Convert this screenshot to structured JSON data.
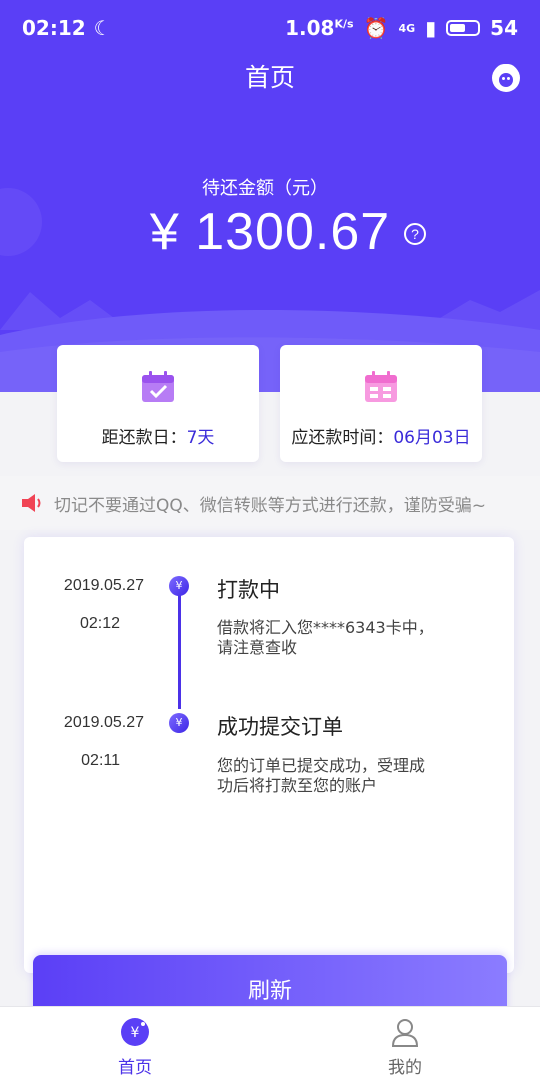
{
  "status_bar": {
    "time": "02:12",
    "speed": "1.08",
    "speed_unit": "K/s",
    "network": "4G",
    "battery": "54"
  },
  "header": {
    "title": "首页"
  },
  "summary": {
    "amount_label": "待还金额（元）",
    "amount": "¥ 1300.67",
    "help_symbol": "?"
  },
  "cards": {
    "days_left_label": "距还款日：",
    "days_left_value": "7天",
    "due_date_label": "应还款时间：",
    "due_date_value": "06月03日"
  },
  "notice": {
    "text": "切记不要通过QQ、微信转账等方式进行还款，谨防受骗~"
  },
  "timeline": [
    {
      "date": "2019.05.27",
      "time": "02:12",
      "dot_symbol": "¥",
      "title": "打款中",
      "desc_line1": "借款将汇入您****6343卡中，",
      "desc_line2": "请注意查收"
    },
    {
      "date": "2019.05.27",
      "time": "02:11",
      "dot_symbol": "¥",
      "title": "成功提交订单",
      "desc_line1": "您的订单已提交成功，受理成",
      "desc_line2": "功后将打款至您的账户"
    }
  ],
  "refresh_label": "刷新",
  "tabbar": {
    "home_label": "首页",
    "mine_label": "我的"
  },
  "colors": {
    "primary": "#5a3ff6",
    "accent_text": "#3a2bd9",
    "notice_icon": "#f04455"
  }
}
